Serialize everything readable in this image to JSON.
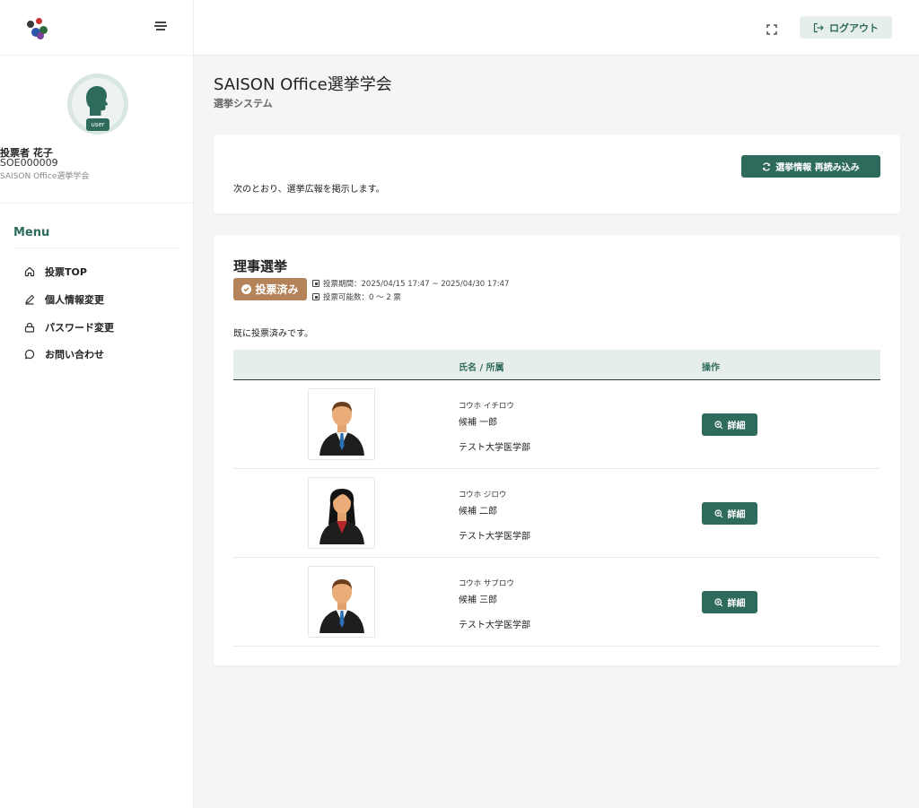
{
  "brand": {
    "logo_colors": [
      "#3a3a3a",
      "#c8312c",
      "#2e6a3a",
      "#2b56a8",
      "#7a3f96"
    ]
  },
  "sidebar": {
    "user": {
      "name": "投票者 花子",
      "id": "SOE000009",
      "org": "SAISON Office選挙学会",
      "role_badge": "user"
    },
    "menu_title": "Menu",
    "items": [
      {
        "label": "投票TOP",
        "icon": "home-icon"
      },
      {
        "label": "個人情報変更",
        "icon": "pencil-icon"
      },
      {
        "label": "パスワード変更",
        "icon": "lock-icon"
      },
      {
        "label": "お問い合わせ",
        "icon": "chat-icon"
      }
    ]
  },
  "topbar": {
    "fullscreen_icon": "fullscreen-icon",
    "logout_label": "ログアウト"
  },
  "page": {
    "title": "SAISON Office選挙学会",
    "subtitle": "選挙システム"
  },
  "info_card": {
    "reload_label": "選挙情報 再読み込み",
    "notice": "次のとおり、選挙広報を掲示します。"
  },
  "election": {
    "title": "理事選挙",
    "badge": "投票済み",
    "period": "投票期間：2025/04/15 17:47 ~ 2025/04/30 17:47",
    "vote_count": "投票可能数：0 〜 2 票",
    "status": "既に投票済みです。",
    "columns": [
      "",
      "氏名 / 所属",
      "操作"
    ],
    "candidates": [
      {
        "kana": "コウホ イチロウ",
        "name": "候補 一郎",
        "dept": "テスト大学医学部",
        "gender": "male",
        "action": "詳細"
      },
      {
        "kana": "コウホ ジロウ",
        "name": "候補 二郎",
        "dept": "テスト大学医学部",
        "gender": "female",
        "action": "詳細"
      },
      {
        "kana": "コウホ サブロウ",
        "name": "候補 三郎",
        "dept": "テスト大学医学部",
        "gender": "male",
        "action": "詳細"
      }
    ]
  },
  "colors": {
    "primary": "#2f6b5c",
    "voted_badge": "#b5835a",
    "table_header_bg": "#e6eeeb"
  }
}
